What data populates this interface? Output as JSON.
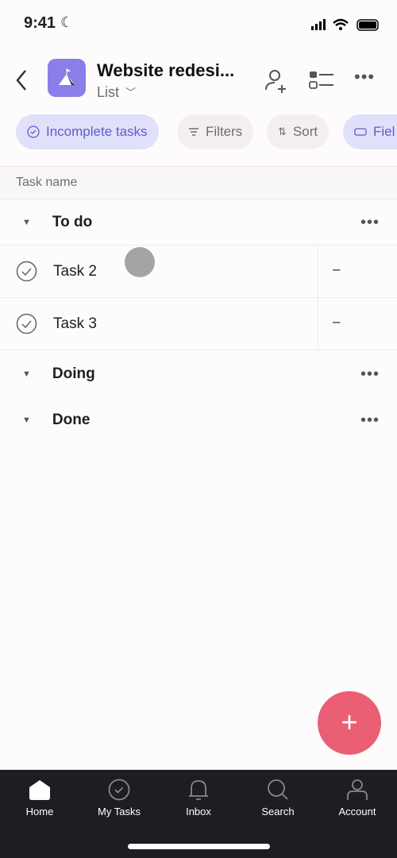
{
  "status": {
    "time": "9:41"
  },
  "header": {
    "title": "Website redesi...",
    "view": "List"
  },
  "chips": [
    {
      "label": "Incomplete tasks"
    },
    {
      "label": "Filters"
    },
    {
      "label": "Sort"
    },
    {
      "label": "Fiel"
    }
  ],
  "table": {
    "column": "Task name"
  },
  "sections": [
    {
      "name": "To do",
      "tasks": [
        {
          "name": "Task 2",
          "value": "–"
        },
        {
          "name": "Task 3",
          "value": "–"
        }
      ]
    },
    {
      "name": "Doing"
    },
    {
      "name": "Done"
    }
  ],
  "colors": {
    "accent": "#8a7ee8",
    "fab": "#ea5f74",
    "tabbar": "#1f1d21"
  },
  "tabs": [
    {
      "label": "Home"
    },
    {
      "label": "My Tasks"
    },
    {
      "label": "Inbox"
    },
    {
      "label": "Search"
    },
    {
      "label": "Account"
    }
  ]
}
